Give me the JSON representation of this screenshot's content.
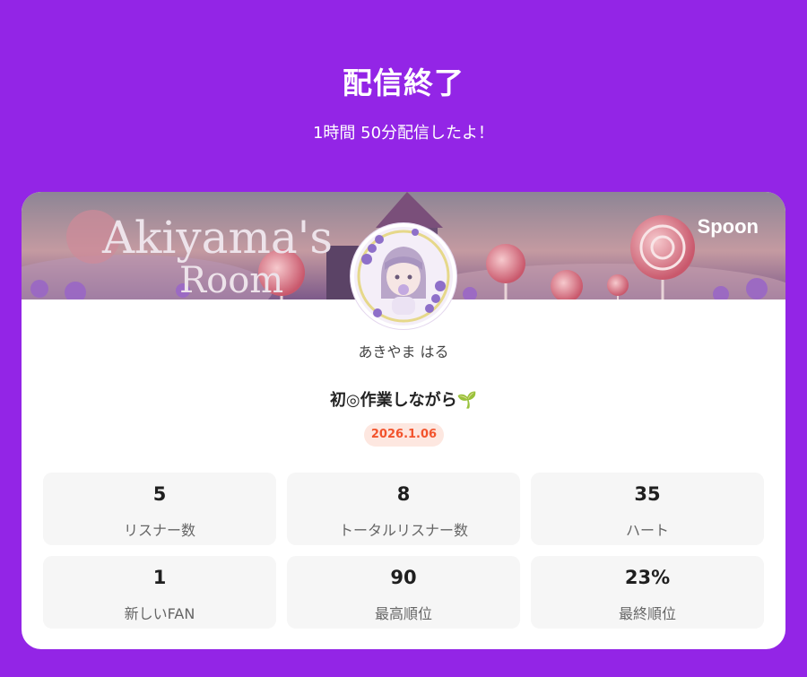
{
  "header": {
    "title": "配信終了",
    "subtitle": "1時間 50分配信したよ！"
  },
  "card": {
    "brand": "Spoon",
    "banner_text": [
      "Akiyama's",
      "Room"
    ],
    "host_name": "あきやま はる",
    "live_title": "初◎作業しながら🌱",
    "date": "2026.1.06",
    "stats": [
      {
        "value": "5",
        "label": "リスナー数"
      },
      {
        "value": "8",
        "label": "トータルリスナー数"
      },
      {
        "value": "35",
        "label": "ハート"
      },
      {
        "value": "1",
        "label": "新しいFAN"
      },
      {
        "value": "90",
        "label": "最高順位"
      },
      {
        "value": "23%",
        "label": "最終順位"
      }
    ]
  },
  "colors": {
    "background": "#9325e6",
    "date_badge_text": "#f2542d",
    "date_badge_bg": "#fde7e0"
  }
}
